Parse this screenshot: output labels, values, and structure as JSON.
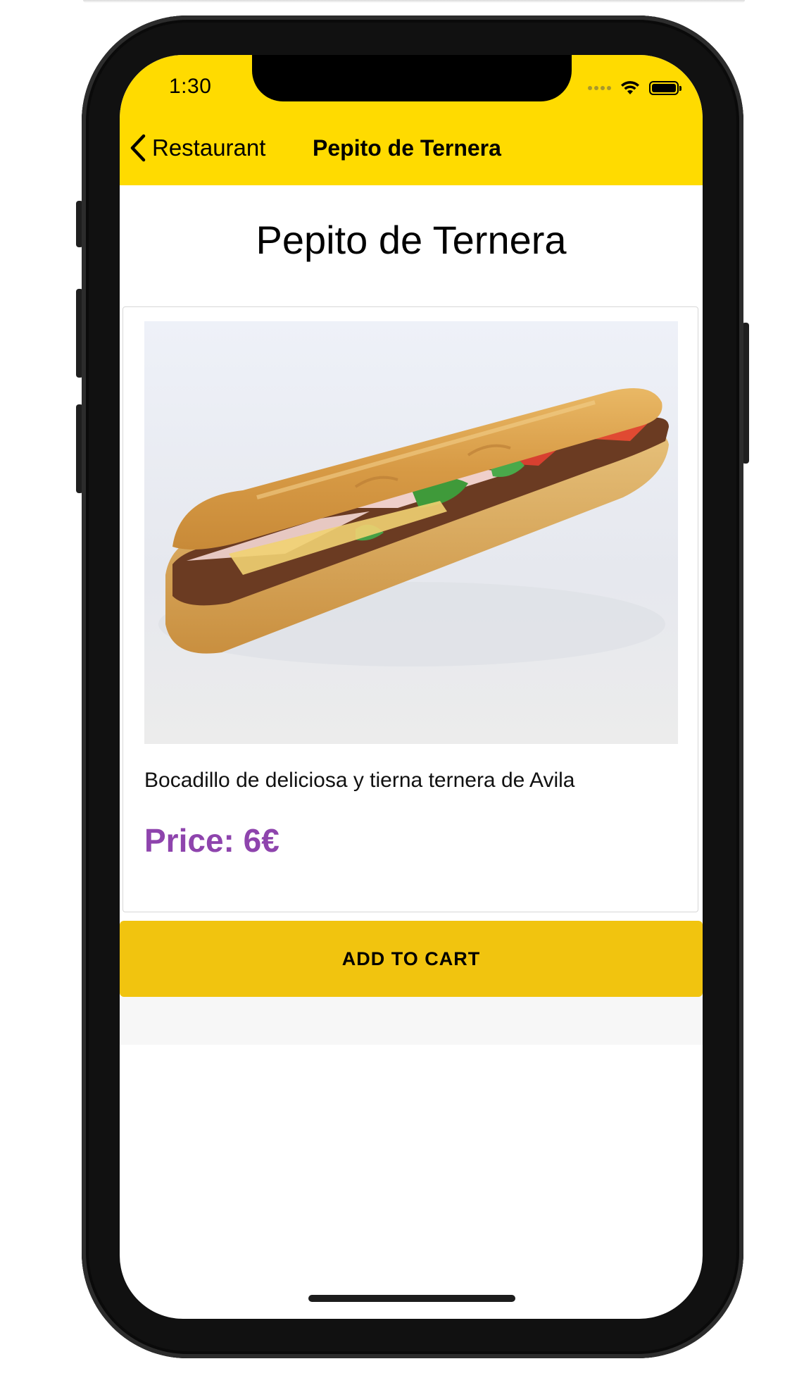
{
  "status_bar": {
    "time": "1:30"
  },
  "nav": {
    "back_label": "Restaurant",
    "title": "Pepito de Ternera"
  },
  "product": {
    "title": "Pepito de Ternera",
    "image_icon": "sandwich-photo",
    "description": "Bocadillo de deliciosa y tierna ternera de Avila",
    "price_label": "Price: 6€"
  },
  "actions": {
    "add_to_cart_label": "ADD TO CART"
  },
  "colors": {
    "header": "#ffdb00",
    "button": "#f1c40f",
    "price": "#8e44ad"
  }
}
